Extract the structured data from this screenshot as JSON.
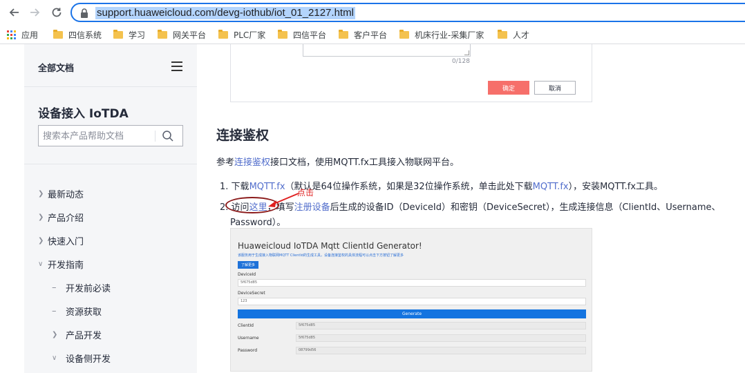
{
  "browser": {
    "url": "support.huaweicloud.com/devg-iothub/iot_01_2127.html",
    "bookmarks": [
      {
        "label": "应用",
        "icon": "apps-grid-icon"
      },
      {
        "label": "四信系统",
        "icon": "folder-icon"
      },
      {
        "label": "学习",
        "icon": "folder-icon"
      },
      {
        "label": "网关平台",
        "icon": "folder-icon"
      },
      {
        "label": "PLC厂家",
        "icon": "folder-icon"
      },
      {
        "label": "四信平台",
        "icon": "folder-icon"
      },
      {
        "label": "客户平台",
        "icon": "folder-icon"
      },
      {
        "label": "机床行业-采集厂家",
        "icon": "folder-icon"
      },
      {
        "label": "人才",
        "icon": "folder-icon"
      }
    ]
  },
  "sidebar": {
    "all_docs": "全部文档",
    "product_title": "设备接入 IoTDA",
    "search_placeholder": "搜索本产品帮助文档",
    "items": [
      {
        "label": "最新动态",
        "state": "collapsed"
      },
      {
        "label": "产品介绍",
        "state": "collapsed"
      },
      {
        "label": "快速入门",
        "state": "collapsed"
      },
      {
        "label": "开发指南",
        "state": "expanded"
      },
      {
        "label": "开发前必读",
        "state": "leaf"
      },
      {
        "label": "资源获取",
        "state": "leaf"
      },
      {
        "label": "产品开发",
        "state": "collapsed"
      },
      {
        "label": "设备侧开发",
        "state": "expanded"
      }
    ]
  },
  "feedback_box": {
    "counter": "0/128",
    "confirm": "确定",
    "cancel": "取消"
  },
  "content": {
    "heading": "连接鉴权",
    "intro_prefix": "参考",
    "intro_link": "连接鉴权",
    "intro_suffix": "接口文档，使用MQTT.fx工具接入物联网平台。",
    "step1": {
      "num": "1.",
      "t1": "下载",
      "link1": "MQTT.fx",
      "t2": "（默认是64位操作系统，如果是32位操作系统，单击此处下载",
      "link2": "MQTT.fx",
      "t3": "），安装MQTT.fx工具。"
    },
    "step2": {
      "num": "2.",
      "t1": "访问",
      "link1": "这里",
      "t2": "，填写",
      "link2": "注册设备",
      "t3": "后生成的设备ID（DeviceId）和密钥（DeviceSecret），生成连接信息（ClientId、Username、",
      "line2": "Password）。"
    },
    "annotation": "点击"
  },
  "generator": {
    "title": "Huaweicloud IoTDA Mqtt ClientId Generator!",
    "desc": "该服务用于生成接入物联网MQTT ClientId的生成工具，设备连接鉴权的具体流程可以点击下方按钮了解更多",
    "learn_more": "了解更多",
    "deviceid_label": "DeviceId",
    "deviceid_value": "5f675d85",
    "devicesecret_label": "DeviceSecret",
    "devicesecret_value": "123",
    "generate": "Generate",
    "rows": [
      {
        "label": "ClientId",
        "value": "5f675d85"
      },
      {
        "label": "Username",
        "value": "5f675d85"
      },
      {
        "label": "Password",
        "value": "08799d56"
      }
    ]
  }
}
